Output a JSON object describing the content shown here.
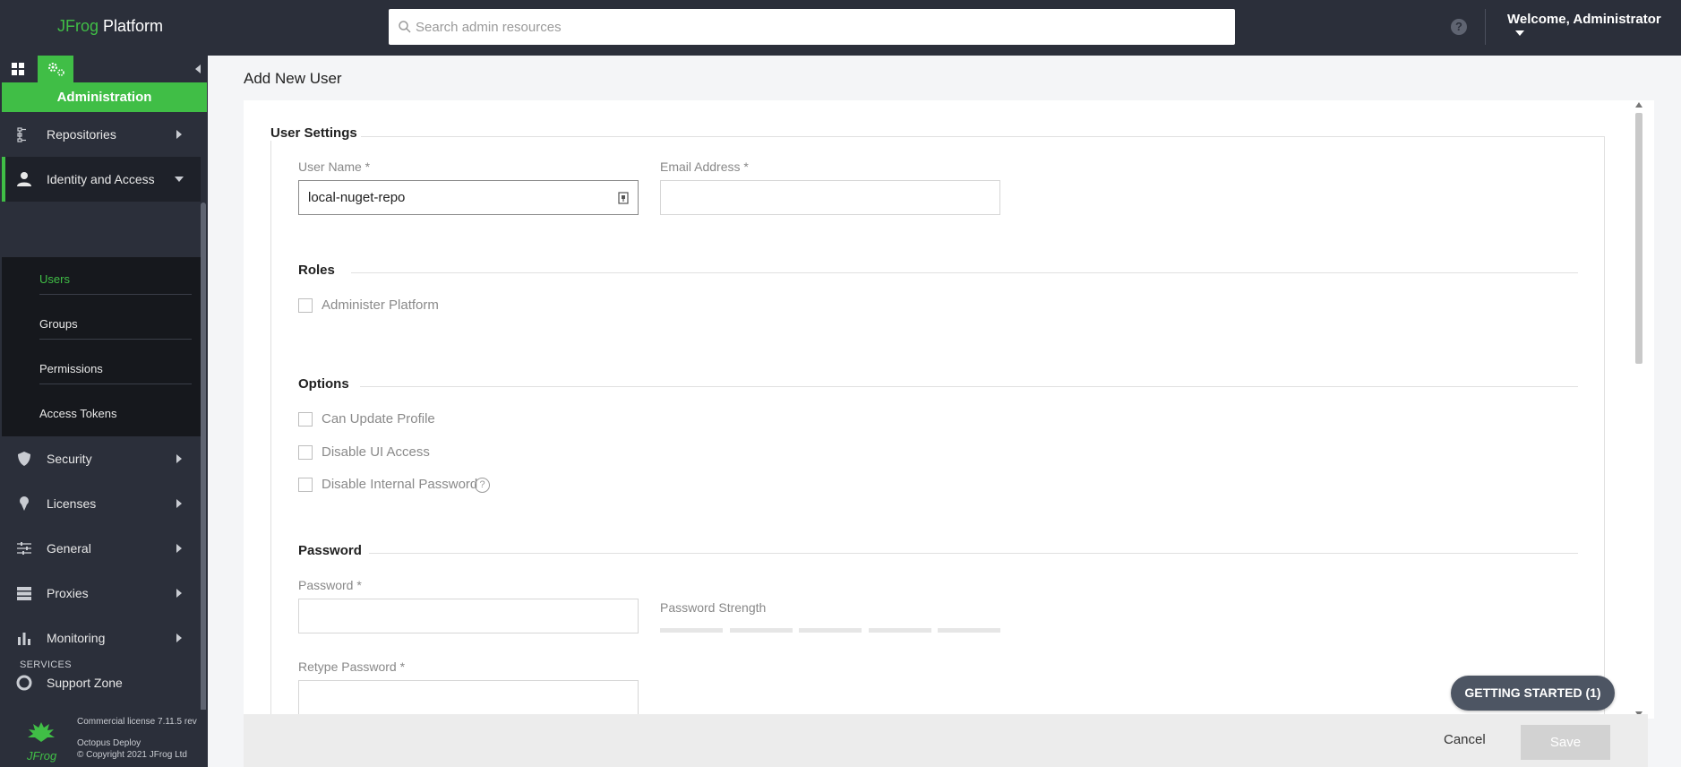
{
  "app": {
    "logo_brand": "JFrog",
    "logo_product": "Platform"
  },
  "header": {
    "search_placeholder": "Search admin resources",
    "help_label": "?",
    "welcome": "Welcome, Administrator"
  },
  "sidebar": {
    "section_title": "Administration",
    "items": [
      {
        "label": "Repositories",
        "icon": "repositories-icon"
      },
      {
        "label": "Identity and Access",
        "icon": "user-icon"
      },
      {
        "label": "Security",
        "icon": "shield-icon"
      },
      {
        "label": "Licenses",
        "icon": "license-icon"
      },
      {
        "label": "General",
        "icon": "sliders-icon"
      },
      {
        "label": "Proxies",
        "icon": "server-icon"
      },
      {
        "label": "Monitoring",
        "icon": "bar-chart-icon"
      },
      {
        "label": "Support Zone",
        "icon": "lifebuoy-icon"
      }
    ],
    "subitems": [
      {
        "label": "Users",
        "selected": true
      },
      {
        "label": "Groups"
      },
      {
        "label": "Permissions"
      },
      {
        "label": "Access Tokens"
      }
    ],
    "services_label": "SERVICES",
    "footer": {
      "logo_text": "JFrog",
      "license": "Commercial license 7.11.5 rev",
      "company": "Octopus Deploy",
      "copyright": "© Copyright 2021 JFrog Ltd"
    },
    "accent_color": "#40be46"
  },
  "main": {
    "page_title": "Add New User",
    "user_settings": {
      "legend": "User Settings",
      "username_label": "User Name *",
      "username_value": "local-nuget-repo",
      "email_label": "Email Address *",
      "email_value": ""
    },
    "roles": {
      "title": "Roles",
      "options": [
        {
          "label": "Administer Platform",
          "checked": false
        }
      ]
    },
    "options": {
      "title": "Options",
      "options": [
        {
          "label": "Can Update Profile",
          "checked": false
        },
        {
          "label": "Disable UI Access",
          "checked": false
        },
        {
          "label": "Disable Internal Password",
          "checked": false
        }
      ],
      "help_label": "?"
    },
    "password": {
      "title": "Password",
      "password_label": "Password *",
      "strength_label": "Password Strength",
      "retype_label": "Retype Password *"
    }
  },
  "getting_started": "GETTING STARTED (1)",
  "footer": {
    "cancel_label": "Cancel",
    "save_label": "Save"
  }
}
